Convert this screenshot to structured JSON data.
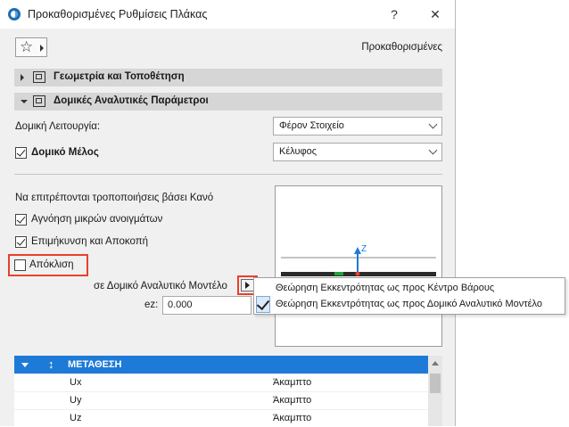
{
  "window": {
    "title": "Προκαθορισμένες Ρυθμίσεις Πλάκας",
    "help_label": "?",
    "close_label": "✕"
  },
  "toolbar": {
    "favorites_icon": "star-icon",
    "preset_label": "Προκαθορισμένες"
  },
  "sections": [
    {
      "label": "Γεωμετρία και Τοποθέτηση",
      "expanded": false
    },
    {
      "label": "Δομικές Αναλυτικές Παράμετροι",
      "expanded": true
    }
  ],
  "structural_function": {
    "label": "Δομική Λειτουργία:",
    "value": "Φέρον Στοιχείο"
  },
  "structural_member": {
    "label": "Δομικό Μέλος",
    "checked": true,
    "value": "Κέλυφος"
  },
  "rules": {
    "heading": "Να επιτρέπονται τροποποιήσεις βάσει Κανό",
    "options": [
      {
        "label": "Αγνόηση μικρών ανοιγμάτων",
        "checked": true
      },
      {
        "label": "Επιμήκυνση και Αποκοπή",
        "checked": true
      },
      {
        "label": "Απόκλιση",
        "checked": false
      }
    ]
  },
  "eccentricity": {
    "label": "σε Δομικό Αναλυτικό Μοντέλο",
    "ez_label": "ez:",
    "ez_value": "0.000"
  },
  "preview": {
    "axis_label": "Z"
  },
  "popup_menu": {
    "items": [
      {
        "label": "Θεώρηση Εκκεντρότητας ως προς Κέντρο Βάρους",
        "selected": false
      },
      {
        "label": "Θεώρηση Εκκεντρότητας ως προς Δομικό Αναλυτικό Μοντέλο",
        "selected": true
      }
    ]
  },
  "table": {
    "header": "ΜΕΤΑΘΕΣΗ",
    "rows": [
      {
        "name": "Ux",
        "value": "Άκαμπτο"
      },
      {
        "name": "Uy",
        "value": "Άκαμπτο"
      },
      {
        "name": "Uz",
        "value": "Άκαμπτο"
      }
    ]
  },
  "colors": {
    "accent": "#1e7ad7",
    "highlight": "#e8412a"
  }
}
